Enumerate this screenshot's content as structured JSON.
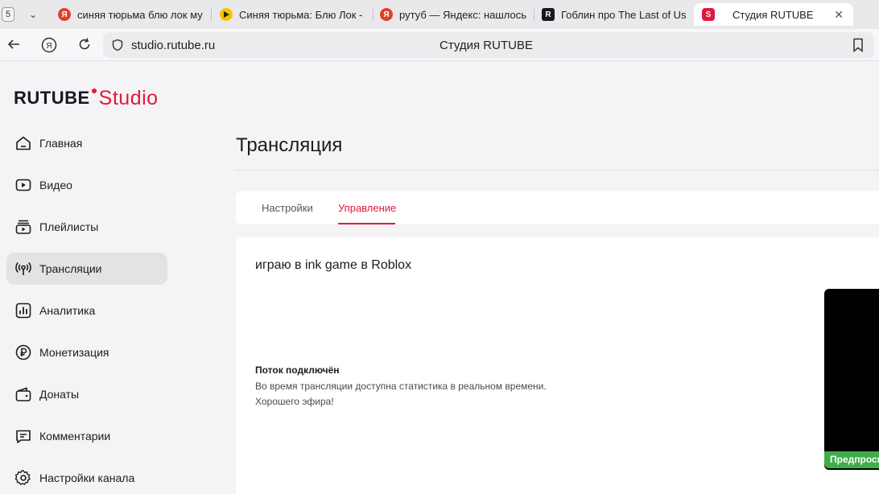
{
  "browser": {
    "tab_count": "5",
    "tabs": [
      {
        "label": "синяя тюрьма блю лок му",
        "favicon": "yandex-icon",
        "color": "#e0402a"
      },
      {
        "label": "Синяя тюрьма: Блю Лок -",
        "favicon": "play-icon",
        "color": "#f5c400"
      },
      {
        "label": "рутуб — Яндекс: нашлось",
        "favicon": "yandex-icon",
        "color": "#e0402a"
      },
      {
        "label": "Гоблин про The Last of Us",
        "favicon": "rutube-r-icon",
        "color": "#14191f"
      },
      {
        "label": "Студия RUTUBE",
        "favicon": "rutube-studio-icon",
        "color": "#e1193c"
      }
    ],
    "url": "studio.rutube.ru",
    "page_title": "Студия RUTUBE"
  },
  "logo": {
    "brand": "RUTUBE",
    "product": "Studio"
  },
  "sidebar": {
    "items": [
      {
        "label": "Главная",
        "icon": "home-icon"
      },
      {
        "label": "Видео",
        "icon": "video-icon"
      },
      {
        "label": "Плейлисты",
        "icon": "playlist-icon"
      },
      {
        "label": "Трансляции",
        "icon": "broadcast-icon"
      },
      {
        "label": "Аналитика",
        "icon": "analytics-icon"
      },
      {
        "label": "Монетизация",
        "icon": "ruble-icon"
      },
      {
        "label": "Донаты",
        "icon": "wallet-icon"
      },
      {
        "label": "Комментарии",
        "icon": "comment-icon"
      },
      {
        "label": "Настройки канала",
        "icon": "gear-icon"
      }
    ]
  },
  "main": {
    "heading": "Трансляция",
    "tabs": [
      "Настройки",
      "Управление"
    ],
    "stream_title": "играю в ink game в Roblox",
    "status_title": "Поток подключён",
    "status_text_1": "Во время трансляции доступна статистика в реальном времени.",
    "status_text_2": "Хорошего эфира!",
    "preview_badge": "Предпросмотр"
  },
  "colors": {
    "accent": "#e1193c",
    "active_nav": "#e3e3e6",
    "badge": "#3fae49"
  }
}
